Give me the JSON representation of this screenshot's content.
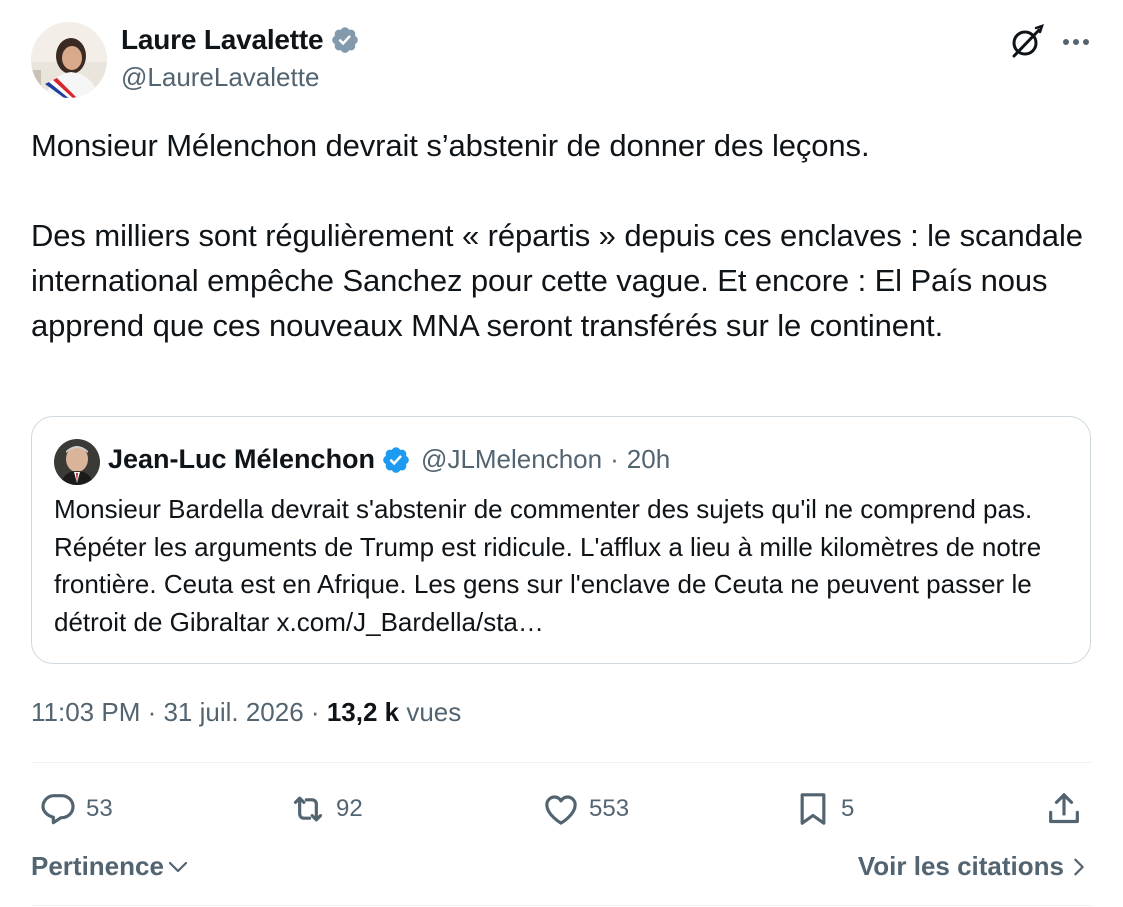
{
  "author": {
    "name": "Laure Lavalette",
    "handle": "@LaureLavalette",
    "verified": true
  },
  "tweet": {
    "paragraphs": [
      "Monsieur Mélenchon devrait s’abstenir de donner des leçons.",
      "Des milliers sont régulièrement « répartis » depuis ces enclaves : le scandale international empêche Sanchez pour cette vague. Et encore : El País nous apprend que ces nouveaux MNA seront transférés sur le continent."
    ]
  },
  "quote": {
    "name": "Jean-Luc Mélenchon",
    "handle": "@JLMelenchon",
    "separator": "·",
    "time": "20h",
    "text": "Monsieur Bardella devrait s'abstenir de commenter des sujets qu'il ne comprend pas. Répéter les arguments de Trump est ridicule. L'afflux a lieu à mille kilomètres de notre frontière. Ceuta est en Afrique. Les gens sur l'enclave de Ceuta ne peuvent passer le détroit de Gibraltar x.com/J_Bardella/sta…"
  },
  "meta": {
    "time": "11:03 PM",
    "separator": " · ",
    "date": "31 juil. 2026",
    "separator2": " · ",
    "views_count": "13,2 k",
    "views_label": " vues"
  },
  "actions": {
    "replies": "53",
    "reposts": "92",
    "likes": "553",
    "bookmarks": "5"
  },
  "footer": {
    "sort_label": "Pertinence",
    "quotes_label": "Voir les citations"
  },
  "colors": {
    "text": "#0f1419",
    "secondary": "#536471",
    "border": "#cfd9de",
    "verified_blue": "#1d9bf0",
    "verified_gray": "#829aab"
  },
  "icons": [
    "grok-icon",
    "more-icon",
    "reply-icon",
    "repost-icon",
    "like-icon",
    "bookmark-icon",
    "share-icon",
    "chevron-down-icon",
    "chevron-right-icon",
    "verified-badge-icon"
  ]
}
